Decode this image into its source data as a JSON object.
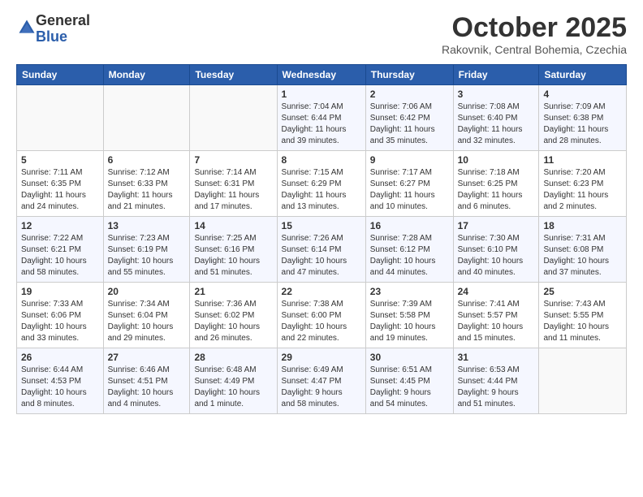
{
  "logo": {
    "general": "General",
    "blue": "Blue"
  },
  "header": {
    "title": "October 2025",
    "location": "Rakovnik, Central Bohemia, Czechia"
  },
  "weekdays": [
    "Sunday",
    "Monday",
    "Tuesday",
    "Wednesday",
    "Thursday",
    "Friday",
    "Saturday"
  ],
  "weeks": [
    [
      {
        "day": "",
        "info": ""
      },
      {
        "day": "",
        "info": ""
      },
      {
        "day": "",
        "info": ""
      },
      {
        "day": "1",
        "info": "Sunrise: 7:04 AM\nSunset: 6:44 PM\nDaylight: 11 hours\nand 39 minutes."
      },
      {
        "day": "2",
        "info": "Sunrise: 7:06 AM\nSunset: 6:42 PM\nDaylight: 11 hours\nand 35 minutes."
      },
      {
        "day": "3",
        "info": "Sunrise: 7:08 AM\nSunset: 6:40 PM\nDaylight: 11 hours\nand 32 minutes."
      },
      {
        "day": "4",
        "info": "Sunrise: 7:09 AM\nSunset: 6:38 PM\nDaylight: 11 hours\nand 28 minutes."
      }
    ],
    [
      {
        "day": "5",
        "info": "Sunrise: 7:11 AM\nSunset: 6:35 PM\nDaylight: 11 hours\nand 24 minutes."
      },
      {
        "day": "6",
        "info": "Sunrise: 7:12 AM\nSunset: 6:33 PM\nDaylight: 11 hours\nand 21 minutes."
      },
      {
        "day": "7",
        "info": "Sunrise: 7:14 AM\nSunset: 6:31 PM\nDaylight: 11 hours\nand 17 minutes."
      },
      {
        "day": "8",
        "info": "Sunrise: 7:15 AM\nSunset: 6:29 PM\nDaylight: 11 hours\nand 13 minutes."
      },
      {
        "day": "9",
        "info": "Sunrise: 7:17 AM\nSunset: 6:27 PM\nDaylight: 11 hours\nand 10 minutes."
      },
      {
        "day": "10",
        "info": "Sunrise: 7:18 AM\nSunset: 6:25 PM\nDaylight: 11 hours\nand 6 minutes."
      },
      {
        "day": "11",
        "info": "Sunrise: 7:20 AM\nSunset: 6:23 PM\nDaylight: 11 hours\nand 2 minutes."
      }
    ],
    [
      {
        "day": "12",
        "info": "Sunrise: 7:22 AM\nSunset: 6:21 PM\nDaylight: 10 hours\nand 58 minutes."
      },
      {
        "day": "13",
        "info": "Sunrise: 7:23 AM\nSunset: 6:19 PM\nDaylight: 10 hours\nand 55 minutes."
      },
      {
        "day": "14",
        "info": "Sunrise: 7:25 AM\nSunset: 6:16 PM\nDaylight: 10 hours\nand 51 minutes."
      },
      {
        "day": "15",
        "info": "Sunrise: 7:26 AM\nSunset: 6:14 PM\nDaylight: 10 hours\nand 47 minutes."
      },
      {
        "day": "16",
        "info": "Sunrise: 7:28 AM\nSunset: 6:12 PM\nDaylight: 10 hours\nand 44 minutes."
      },
      {
        "day": "17",
        "info": "Sunrise: 7:30 AM\nSunset: 6:10 PM\nDaylight: 10 hours\nand 40 minutes."
      },
      {
        "day": "18",
        "info": "Sunrise: 7:31 AM\nSunset: 6:08 PM\nDaylight: 10 hours\nand 37 minutes."
      }
    ],
    [
      {
        "day": "19",
        "info": "Sunrise: 7:33 AM\nSunset: 6:06 PM\nDaylight: 10 hours\nand 33 minutes."
      },
      {
        "day": "20",
        "info": "Sunrise: 7:34 AM\nSunset: 6:04 PM\nDaylight: 10 hours\nand 29 minutes."
      },
      {
        "day": "21",
        "info": "Sunrise: 7:36 AM\nSunset: 6:02 PM\nDaylight: 10 hours\nand 26 minutes."
      },
      {
        "day": "22",
        "info": "Sunrise: 7:38 AM\nSunset: 6:00 PM\nDaylight: 10 hours\nand 22 minutes."
      },
      {
        "day": "23",
        "info": "Sunrise: 7:39 AM\nSunset: 5:58 PM\nDaylight: 10 hours\nand 19 minutes."
      },
      {
        "day": "24",
        "info": "Sunrise: 7:41 AM\nSunset: 5:57 PM\nDaylight: 10 hours\nand 15 minutes."
      },
      {
        "day": "25",
        "info": "Sunrise: 7:43 AM\nSunset: 5:55 PM\nDaylight: 10 hours\nand 11 minutes."
      }
    ],
    [
      {
        "day": "26",
        "info": "Sunrise: 6:44 AM\nSunset: 4:53 PM\nDaylight: 10 hours\nand 8 minutes."
      },
      {
        "day": "27",
        "info": "Sunrise: 6:46 AM\nSunset: 4:51 PM\nDaylight: 10 hours\nand 4 minutes."
      },
      {
        "day": "28",
        "info": "Sunrise: 6:48 AM\nSunset: 4:49 PM\nDaylight: 10 hours\nand 1 minute."
      },
      {
        "day": "29",
        "info": "Sunrise: 6:49 AM\nSunset: 4:47 PM\nDaylight: 9 hours\nand 58 minutes."
      },
      {
        "day": "30",
        "info": "Sunrise: 6:51 AM\nSunset: 4:45 PM\nDaylight: 9 hours\nand 54 minutes."
      },
      {
        "day": "31",
        "info": "Sunrise: 6:53 AM\nSunset: 4:44 PM\nDaylight: 9 hours\nand 51 minutes."
      },
      {
        "day": "",
        "info": ""
      }
    ]
  ]
}
